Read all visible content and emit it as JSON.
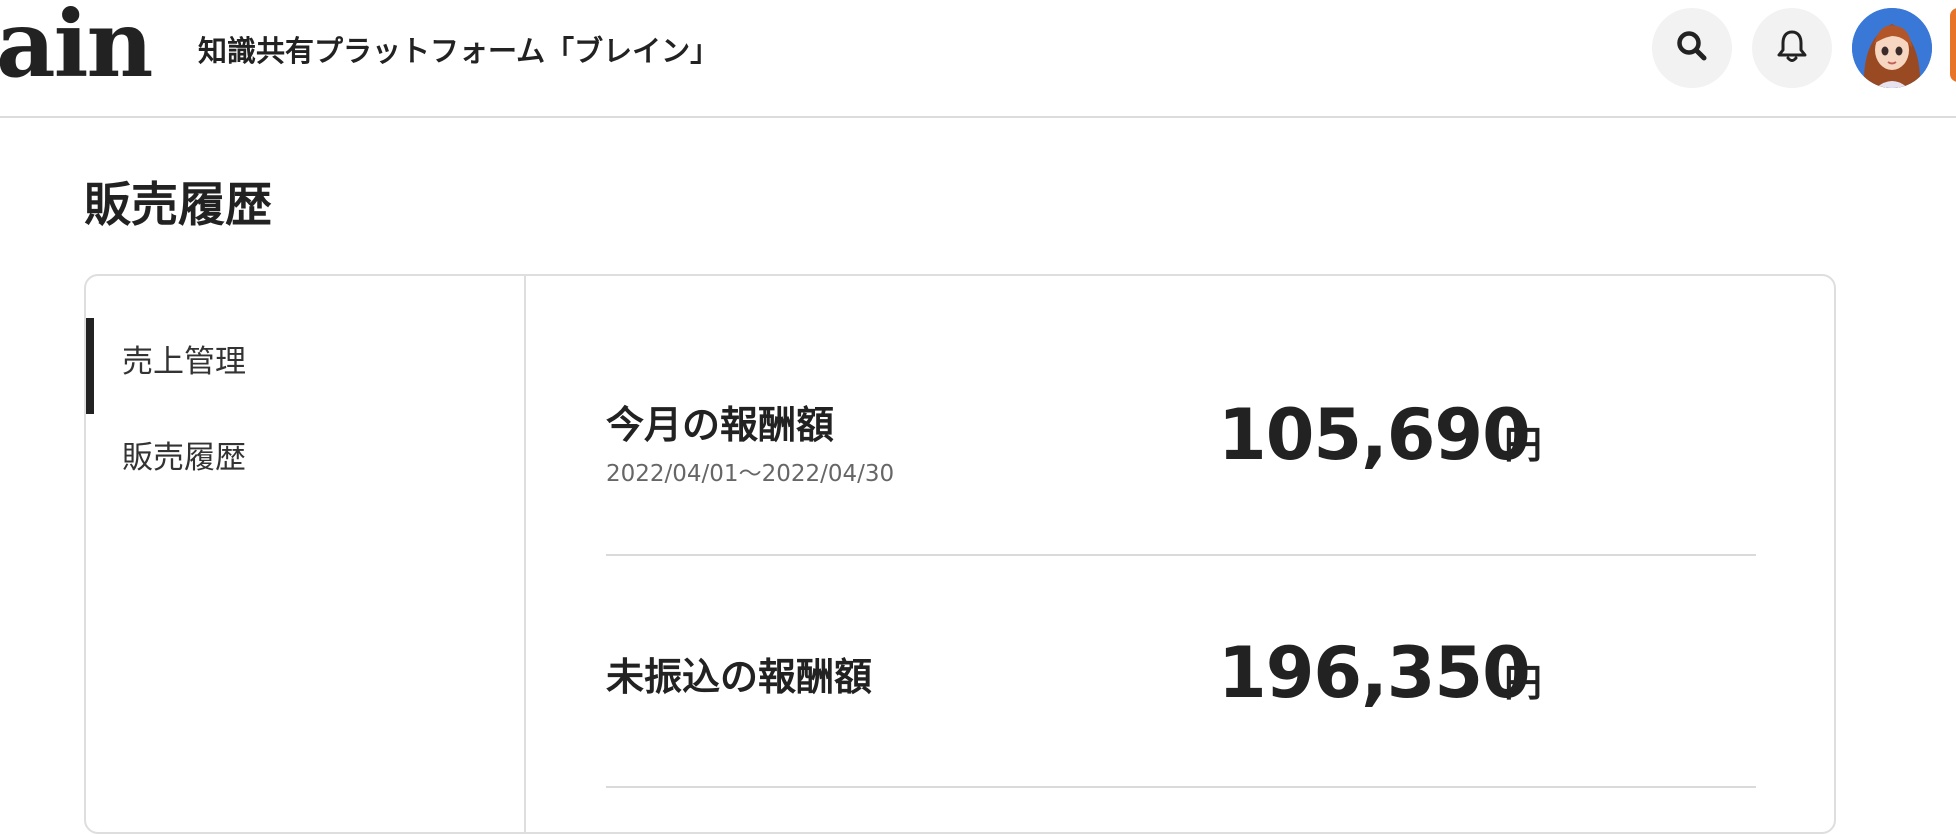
{
  "header": {
    "logo_text": "ain",
    "site_title": "知識共有プラットフォーム「ブレイン」",
    "icons": [
      "search-icon",
      "bell-icon"
    ],
    "accent_color": "#e8742a"
  },
  "page": {
    "title": "販売履歴"
  },
  "sidebar": {
    "items": [
      {
        "label": "売上管理",
        "active": true
      },
      {
        "label": "販売履歴",
        "active": false
      }
    ]
  },
  "summary": {
    "rows": [
      {
        "label": "今月の報酬額",
        "period": "2022/04/01〜2022/04/30",
        "amount": "105,690",
        "unit": "円"
      },
      {
        "label": "未振込の報酬額",
        "amount": "196,350",
        "unit": "円"
      }
    ]
  }
}
